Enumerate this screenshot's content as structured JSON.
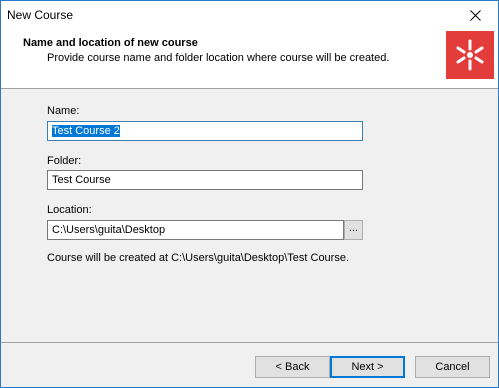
{
  "window": {
    "title": "New Course"
  },
  "header": {
    "title": "Name and location of new course",
    "subtitle": "Provide course name and folder location where course will be created.",
    "logo_color": "#e23c3b"
  },
  "form": {
    "name_label": "Name:",
    "name_value": "Test Course 2",
    "folder_label": "Folder:",
    "folder_value": "Test Course",
    "location_label": "Location:",
    "location_value": "C:\\Users\\guita\\Desktop",
    "browse_label": "...",
    "info_text": "Course will be created at C:\\Users\\guita\\Desktop\\Test Course."
  },
  "buttons": {
    "back": "< Back",
    "next": "Next >",
    "cancel": "Cancel"
  },
  "icons": {
    "close": "close-icon",
    "logo": "app-logo-icon"
  },
  "colors": {
    "accent": "#0078d7",
    "selection": "#0078d7"
  }
}
